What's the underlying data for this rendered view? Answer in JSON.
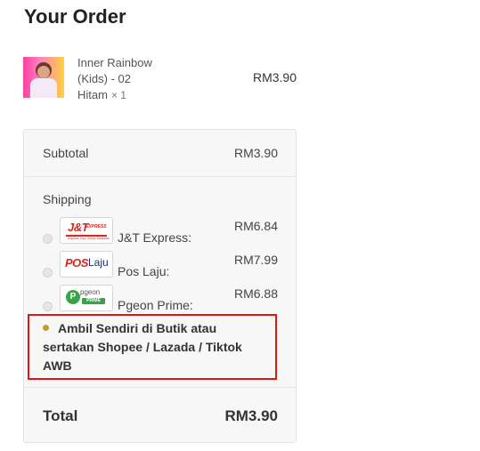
{
  "page": {
    "title": "Your Order"
  },
  "product": {
    "name_line1": "Inner Rainbow",
    "name_line2": "(Kids) - 02",
    "variant": "Hitam",
    "quantity": "× 1",
    "price": "RM3.90"
  },
  "summary": {
    "subtotal_label": "Subtotal",
    "subtotal_value": "RM3.90",
    "shipping_label": "Shipping",
    "total_label": "Total",
    "total_value": "RM3.90"
  },
  "shipping_options": [
    {
      "name": "J&T Express:",
      "price": "RM6.84",
      "logo": "jt-express-logo",
      "selected": false,
      "logo_text": "J&T",
      "logo_subtext": "EXPRESS",
      "logo_tagline": "Express Your Online Business"
    },
    {
      "name": "Pos Laju:",
      "price": "RM7.99",
      "logo": "pos-laju-logo",
      "selected": false,
      "logo_text": "POS",
      "logo_subtext": "Laju"
    },
    {
      "name": "Pgeon Prime:",
      "price": "RM6.88",
      "logo": "pgeon-prime-logo",
      "selected": false,
      "logo_text": "P",
      "logo_subtext": "pgeon",
      "logo_tagline": "PRIME"
    },
    {
      "name": "Ambil Sendiri di Butik atau sertakan Shopee / Lazada / Tiktok AWB",
      "price": "",
      "selected": true
    }
  ],
  "colors": {
    "highlight_border": "#e31414",
    "selected_radio": "#c89a2e",
    "card_background": "#f7f7f7"
  }
}
